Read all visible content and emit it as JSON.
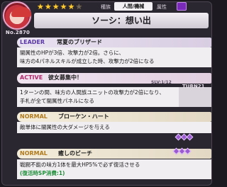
{
  "card": {
    "number": "No.2870",
    "rarity": {
      "filled": 5,
      "total": 6
    },
    "race_label": "種族",
    "race_value": "人間/機械",
    "attribute_label": "属性",
    "attribute_color": "#7a2ab8",
    "title": "ソーシ：想い出"
  },
  "leader": {
    "tag": "LEADER",
    "name": "常夏のブリザード",
    "lines": [
      "闇属性のHPが3倍、攻撃力が2倍。さらに、",
      "味方の4パネルスキルが成立した時、攻撃力が2倍になる"
    ]
  },
  "active": {
    "tag": "ACTIVE",
    "name": "彼女募集中！",
    "slv": "SLV:1/12",
    "turn": "TURN21",
    "lines": [
      "1ターンの間、味方の人間族ユニットの攻撃力が2倍になり、",
      "手札が全て闇属性パネルになる"
    ]
  },
  "normal1": {
    "tag": "NORMAL",
    "name": "ブローケン・ハート",
    "lines": [
      "敵単体に闇属性の大ダメージを与える"
    ]
  },
  "normal2": {
    "tag": "NORMAL",
    "name": "癒しのビーチ",
    "lines": [
      "戦闘不能の味方1体を最大HP5%で必ず復活させる"
    ],
    "sp_note": "(復活時SP消費:1)"
  },
  "colors": {
    "accent_purple": "#7a2ab8",
    "leader_tag": "#5b3aa8",
    "active_tag": "#b0286a",
    "normal_tag": "#b07a1c",
    "sp_green": "#1f8f3a",
    "star": "#ffcc33"
  }
}
